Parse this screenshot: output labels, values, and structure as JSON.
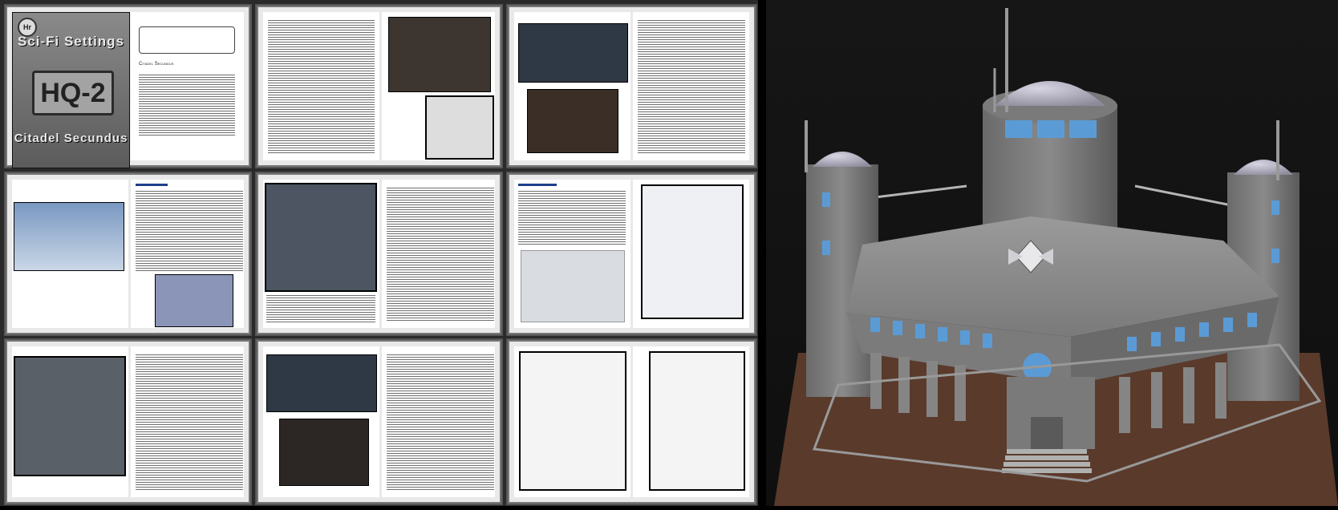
{
  "product": {
    "publisher_logo": "Hr",
    "line_title": "Sci-Fi Settings",
    "model": "HQ-2",
    "subtitle": "Citadel Secundus"
  },
  "toc": {
    "heading": "Citadel Secundus"
  },
  "icons": {
    "logo": "publisher-logo-icon"
  },
  "colors": {
    "background": "#000000",
    "grid_bg": "#2a2a2a",
    "page": "#ffffff",
    "accent_blue": "#5b9bd5"
  }
}
